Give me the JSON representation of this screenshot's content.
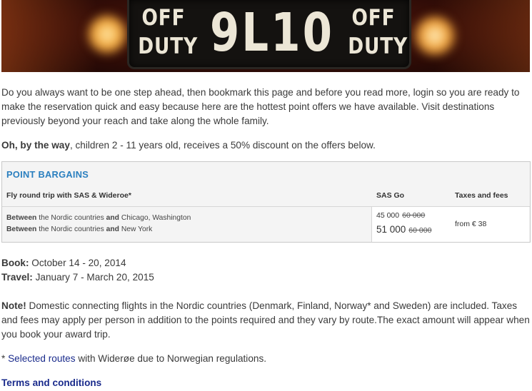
{
  "banner": {
    "left_top": "OFF",
    "left_bottom": "DUTY",
    "plate_number": "9L10",
    "right_top": "OFF",
    "right_bottom": "DUTY"
  },
  "intro": "Do you always want to be one step ahead, then bookmark this page and before you read more, login so you are ready to make the reservation quick and easy because here are the hottest point offers we have available. Visit destinations previously beyond your reach and take along the whole family.",
  "kids": {
    "bold": "Oh, by the way",
    "rest": ", children 2 - 11 years old, receives a 50% discount on the offers below."
  },
  "offers": {
    "heading": "POINT BARGAINS",
    "headers": {
      "route": "Fly round trip with SAS & Wideroe*",
      "sas_go": "SAS Go",
      "taxes": "Taxes and fees"
    },
    "routes": [
      {
        "between": "Between",
        "from": " the Nordic countries ",
        "and": "and",
        "to": " Chicago, Washington"
      },
      {
        "between": "Between",
        "from": " the Nordic countries ",
        "and": "and",
        "to": " New York"
      }
    ],
    "prices": [
      {
        "now": "45 000",
        "was": "60 000"
      },
      {
        "now": "51 000",
        "was": "60 000"
      }
    ],
    "fees": "from € 38"
  },
  "book": {
    "label": "Book:",
    "value": " October 14 - 20, 2014"
  },
  "travel": {
    "label": "Travel:",
    "value": " January 7 - March 20, 2015"
  },
  "note": {
    "label": "Note!",
    "text": " Domestic connecting flights in the Nordic countries (Denmark, Finland, Norway* and Sweden) are included. Taxes and fees may apply per person in addition to the points required and they vary by route.The exact amount will appear when you book your award trip."
  },
  "selected": {
    "prefix": "* ",
    "link": "Selected routes",
    "suffix": " with Widerøe due to Norwegian regulations."
  },
  "terms": "Terms and conditions",
  "colors": {
    "heading": "#2a7fbf",
    "link": "#1a2b8c"
  }
}
